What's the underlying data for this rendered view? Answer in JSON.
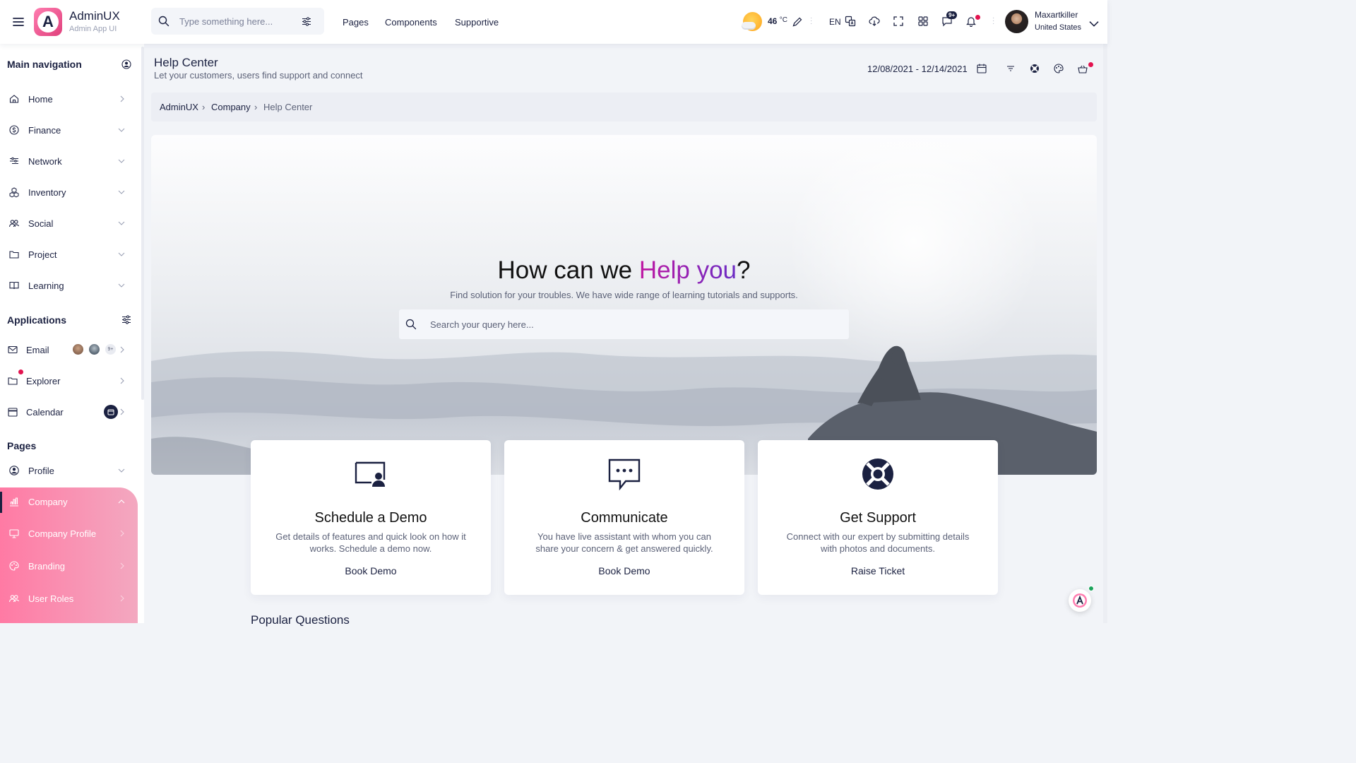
{
  "app": {
    "name": "AdminUX",
    "subtitle": "Admin App UI",
    "logo_letter": "A"
  },
  "search": {
    "placeholder": "Type something here..."
  },
  "topnav": [
    "Pages",
    "Components",
    "Supportive"
  ],
  "weather": {
    "temp": "46",
    "unit": "°C"
  },
  "language": "EN",
  "messages_badge": "9+",
  "user": {
    "name": "Maxartkiller",
    "country": "United States"
  },
  "sidebar": {
    "main_heading": "Main navigation",
    "main_items": [
      "Home",
      "Finance",
      "Network",
      "Inventory",
      "Social",
      "Project",
      "Learning"
    ],
    "apps_heading": "Applications",
    "apps": [
      "Email",
      "Explorer",
      "Calendar"
    ],
    "email_more": "9+",
    "pages_heading": "Pages",
    "pages": [
      "Profile",
      "Company",
      "Company Profile",
      "Branding",
      "User Roles"
    ]
  },
  "page": {
    "title": "Help Center",
    "subtitle": "Let your customers, users find support and connect",
    "daterange": "12/08/2021 - 12/14/2021"
  },
  "breadcrumb": [
    "AdminUX",
    "Company",
    "Help Center"
  ],
  "hero": {
    "title_pre": "How can we ",
    "title_hl": "Help you",
    "title_post": "?",
    "subtitle": "Find solution for your troubles. We have wide range of learning tutorials and supports.",
    "search_placeholder": "Search your query here..."
  },
  "cards": [
    {
      "title": "Schedule a Demo",
      "desc": "Get details of features and quick look on how it works. Schedule a demo now.",
      "link": "Book Demo",
      "icon": "presentation-icon"
    },
    {
      "title": "Communicate",
      "desc": "You have live assistant with whom you can share your concern & get answered quickly.",
      "link": "Book Demo",
      "icon": "chat-icon"
    },
    {
      "title": "Get Support",
      "desc": "Connect with our expert by submitting details with photos and documents.",
      "link": "Raise Ticket",
      "icon": "lifebuoy-icon"
    }
  ],
  "popular_heading": "Popular Questions",
  "colors": {
    "brand": "#1b2141",
    "accent_pink": "#ff7aa4",
    "highlight_start": "#c01aa3",
    "highlight_end": "#6a2bc4",
    "alert": "#e3134f"
  }
}
